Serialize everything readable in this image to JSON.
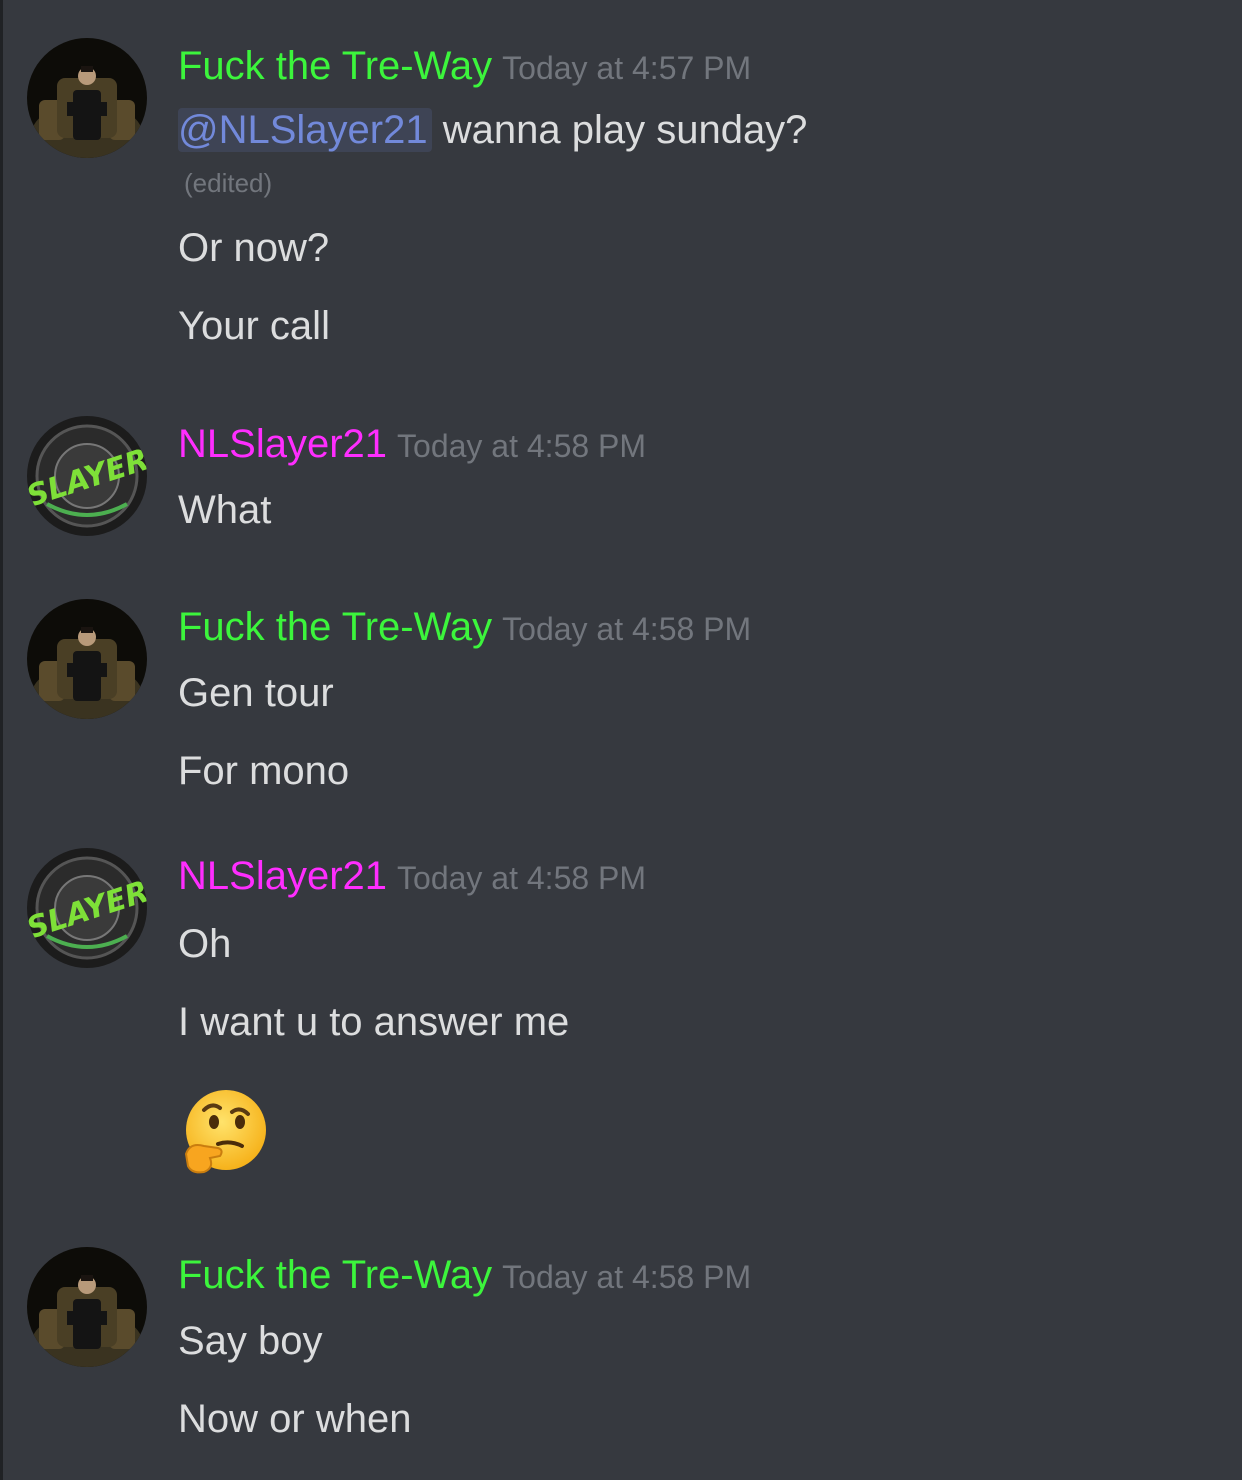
{
  "theme": {
    "background": "#36393f",
    "user1_color": "#3cf53c",
    "user2_color": "#ff2dff",
    "mention_color": "#7289da",
    "timestamp_color": "#72767d",
    "text_color": "#dcddde"
  },
  "messages": [
    {
      "username": "Fuck the Tre-Way",
      "timestamp": "Today at 4:57 PM",
      "avatar": "godfather-avatar",
      "first_line": {
        "mention": "@NLSlayer21",
        "text": " wanna play sunday?",
        "edited": "(edited)"
      },
      "lines": [
        "Or now?",
        "Your call"
      ]
    },
    {
      "username": "NLSlayer21",
      "timestamp": "Today at 4:58 PM",
      "avatar": "slayer-logo-avatar",
      "lines": [
        "What"
      ]
    },
    {
      "username": "Fuck the Tre-Way",
      "timestamp": "Today at 4:58 PM",
      "avatar": "godfather-avatar",
      "lines": [
        "Gen tour",
        "For mono"
      ]
    },
    {
      "username": "NLSlayer21",
      "timestamp": "Today at 4:58 PM",
      "avatar": "slayer-logo-avatar",
      "lines": [
        "Oh",
        "I want u to answer me"
      ],
      "emoji": "thinking-face-emoji"
    },
    {
      "username": "Fuck the Tre-Way",
      "timestamp": "Today at 4:58 PM",
      "avatar": "godfather-avatar",
      "lines": [
        "Say boy",
        "Now or when"
      ]
    }
  ]
}
